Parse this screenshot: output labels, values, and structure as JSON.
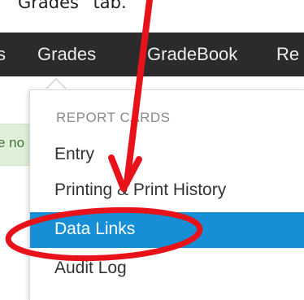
{
  "caption": "Grades” tab.",
  "navbar": {
    "items": [
      {
        "label": "s"
      },
      {
        "label": "Grades"
      },
      {
        "label": "GradeBook"
      },
      {
        "label": "Re"
      }
    ]
  },
  "background": {
    "notice_fragment": "e no"
  },
  "dropdown": {
    "section_header": "REPORT CARDS",
    "items": [
      {
        "label": "Entry"
      },
      {
        "label": "Printing & Print History"
      },
      {
        "label": "Data Links"
      },
      {
        "label": "Audit Log"
      }
    ],
    "selected_item": "Data Links"
  },
  "colors": {
    "navbar": "#2b2b2b",
    "active_item": "#168fd6",
    "annotation": "#e8131a",
    "notice": "#dff0d8"
  }
}
